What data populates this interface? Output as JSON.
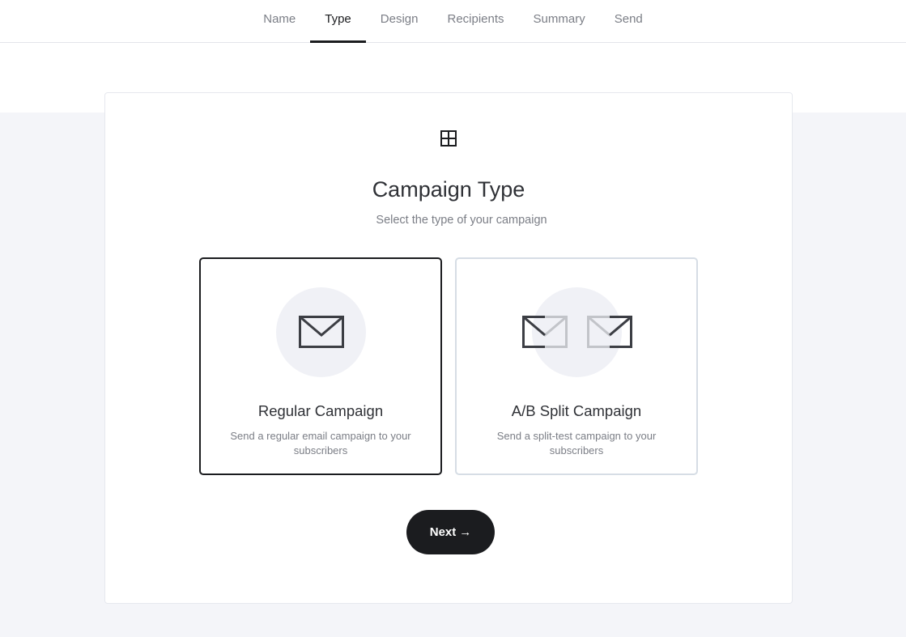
{
  "tabs": [
    {
      "label": "Name",
      "active": false
    },
    {
      "label": "Type",
      "active": true
    },
    {
      "label": "Design",
      "active": false
    },
    {
      "label": "Recipients",
      "active": false
    },
    {
      "label": "Summary",
      "active": false
    },
    {
      "label": "Send",
      "active": false
    }
  ],
  "header": {
    "icon": "grid-icon",
    "title": "Campaign Type",
    "subtitle": "Select the type of your campaign"
  },
  "options": [
    {
      "title": "Regular Campaign",
      "description": "Send a regular email campaign to your subscribers",
      "icon": "envelope-icon",
      "selected": true
    },
    {
      "title": "A/B Split Campaign",
      "description": "Send a split-test campaign to your subscribers",
      "icon": "split-envelopes-icon",
      "selected": false
    }
  ],
  "next_button": {
    "label": "Next",
    "arrow": "→"
  },
  "colors": {
    "accent": "#1b1c1f",
    "muted_text": "#7b7e86",
    "page_background": "#f4f5f9",
    "selected_border": "#1b1c1f",
    "unselected_border": "#d6dde5"
  }
}
